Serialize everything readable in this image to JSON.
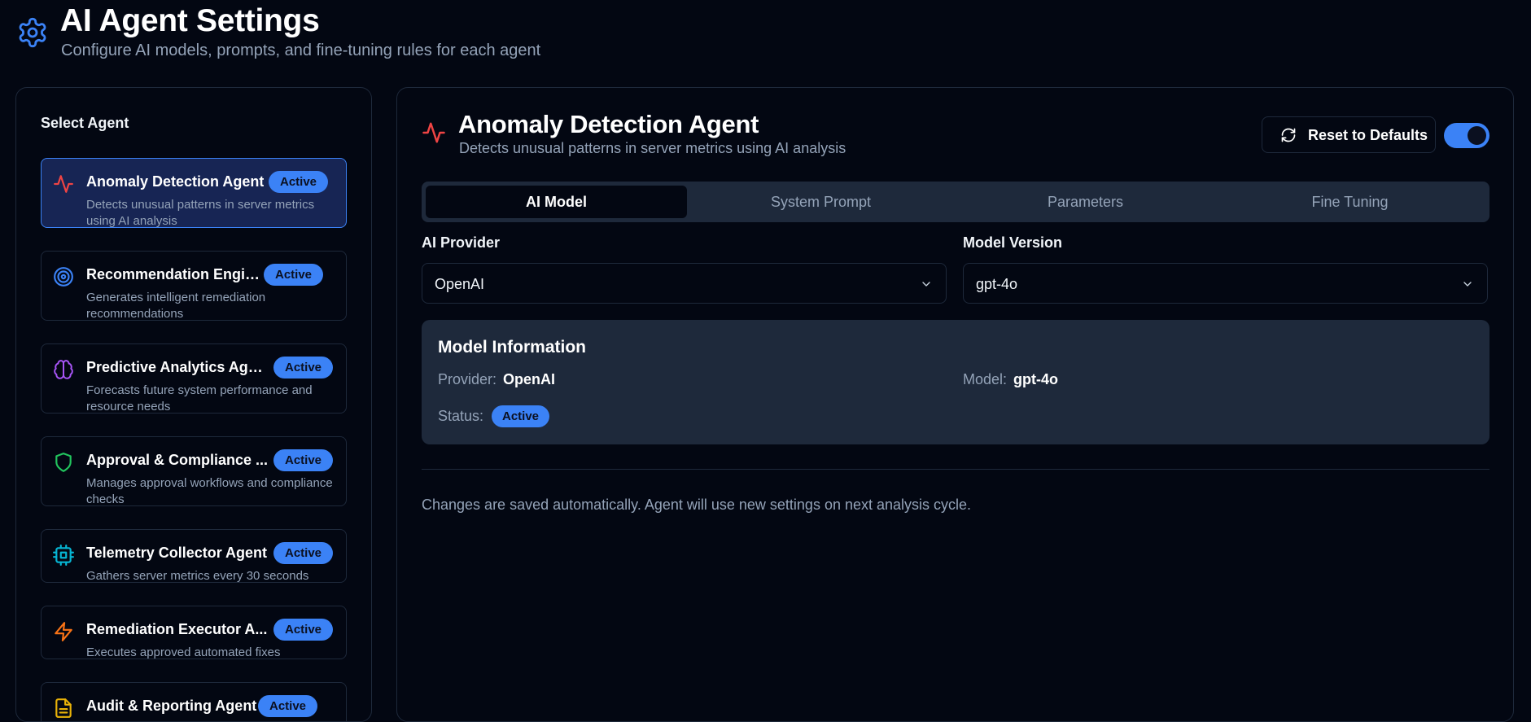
{
  "header": {
    "title": "AI Agent Settings",
    "subtitle": "Configure AI models, prompts, and fine-tuning rules for each agent",
    "icon": "gear-icon"
  },
  "sidebar": {
    "title": "Select Agent",
    "agents": [
      {
        "name": "Anomaly Detection Agent",
        "badge": "Active",
        "description": "Detects unusual patterns in server metrics using AI analysis",
        "icon": "activity-icon",
        "color": "#ef4444",
        "selected": true
      },
      {
        "name": "Recommendation Engine",
        "badge": "Active",
        "description": "Generates intelligent remediation recommendations",
        "icon": "target-icon",
        "color": "#3b82f6"
      },
      {
        "name": "Predictive Analytics Agent",
        "badge": "Active",
        "description": "Forecasts future system performance and resource needs",
        "icon": "brain-icon",
        "color": "#a855f7"
      },
      {
        "name": "Approval & Compliance ...",
        "badge": "Active",
        "description": "Manages approval workflows and compliance checks",
        "icon": "shield-icon",
        "color": "#22c55e"
      },
      {
        "name": "Telemetry Collector Agent",
        "badge": "Active",
        "description": "Gathers server metrics every 30 seconds",
        "icon": "cpu-icon",
        "color": "#06b6d4"
      },
      {
        "name": "Remediation Executor A...",
        "badge": "Active",
        "description": "Executes approved automated fixes",
        "icon": "zap-icon",
        "color": "#f97316"
      },
      {
        "name": "Audit & Reporting Agent",
        "badge": "Active",
        "description": "",
        "icon": "file-text-icon",
        "color": "#eab308"
      }
    ]
  },
  "main": {
    "agent_title": "Anomaly Detection Agent",
    "agent_description": "Detects unusual patterns in server metrics using AI analysis",
    "reset_label": "Reset to Defaults",
    "toggle_on": true,
    "tabs": [
      {
        "label": "AI Model",
        "active": true
      },
      {
        "label": "System Prompt"
      },
      {
        "label": "Parameters"
      },
      {
        "label": "Fine Tuning"
      }
    ],
    "provider": {
      "label": "AI Provider",
      "value": "OpenAI"
    },
    "model_version": {
      "label": "Model Version",
      "value": "gpt-4o"
    },
    "info": {
      "title": "Model Information",
      "provider_key": "Provider:",
      "provider_value": "OpenAI",
      "model_key": "Model:",
      "model_value": "gpt-4o",
      "status_key": "Status:",
      "status_value": "Active"
    },
    "note": "Changes are saved automatically. Agent will use new settings on next analysis cycle."
  },
  "colors": {
    "background": "#030712",
    "accent": "#3b82f6",
    "card": "#1e293b",
    "muted_text": "#94a3b8"
  }
}
